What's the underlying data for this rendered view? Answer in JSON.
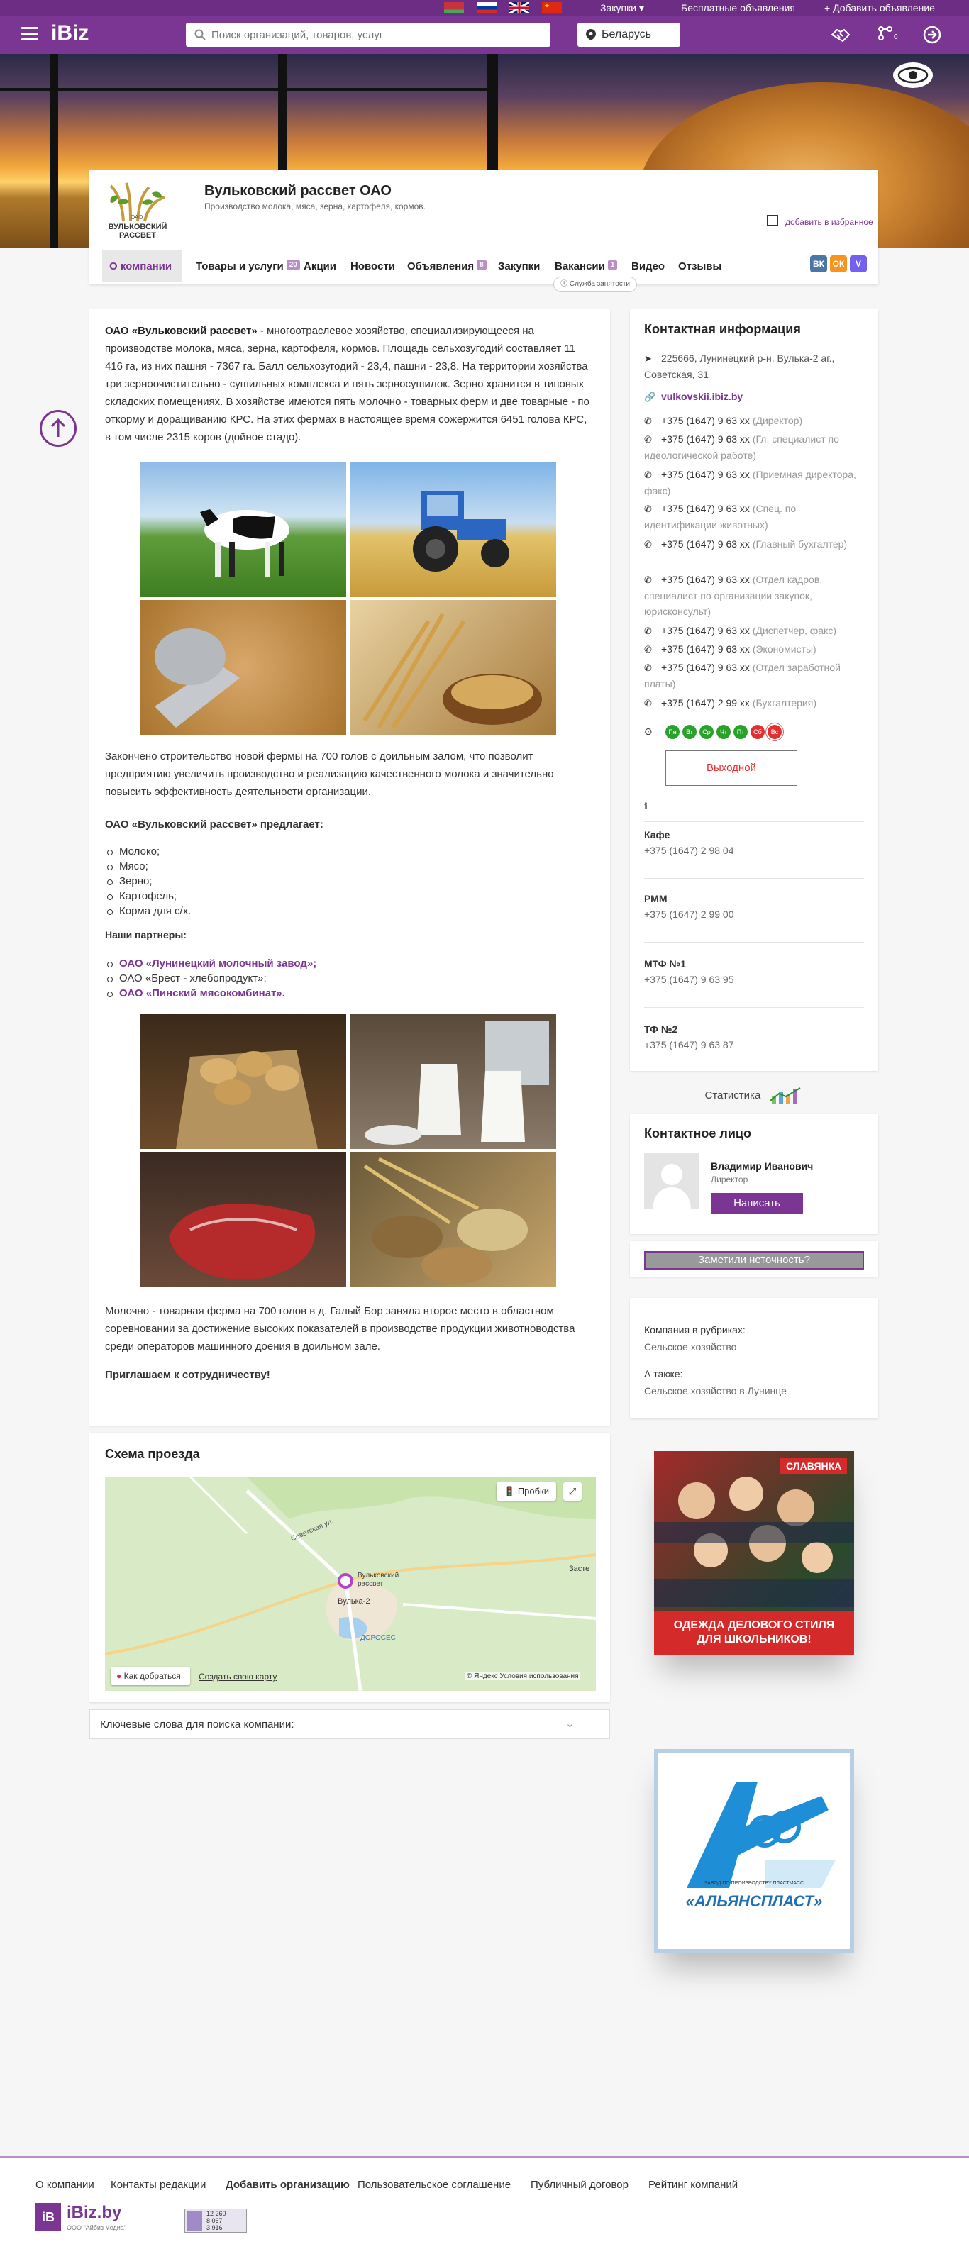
{
  "topbar": {
    "flags": [
      "by-flag",
      "ru-flag",
      "uk-flag",
      "cn-flag"
    ],
    "purchases": "Закупки",
    "free_ads": "Бесплатные объявления",
    "add_ad": "Добавить объявление"
  },
  "header": {
    "logo": "iBiz",
    "search_placeholder": "Поиск организаций, товаров, услуг",
    "country": "Беларусь",
    "notification_count": "0"
  },
  "company": {
    "logo_text": "ВУЛЬКОВСКИЙ РАССВЕТ",
    "logo_small": "ОАО",
    "name": "Вульковский рассвет ОАО",
    "description": "Производство молока, мяса, зерна, картофеля, кормов.",
    "favorite": "добавить в избранное"
  },
  "tabs": [
    {
      "label": "О компании"
    },
    {
      "label": "Товары и услуги",
      "badge": "20"
    },
    {
      "label": "Акции"
    },
    {
      "label": "Новости"
    },
    {
      "label": "Объявления",
      "badge": "8"
    },
    {
      "label": "Закупки"
    },
    {
      "label": "Вакансии",
      "badge": "1"
    },
    {
      "label": "Видео"
    },
    {
      "label": "Отзывы"
    }
  ],
  "social": [
    "ВК",
    "ОК",
    "V"
  ],
  "support": "Служба занятости",
  "about": {
    "intro_bold": "ОАО «Вульковский рассвет»",
    "intro": " - многоотраслевое хозяйство, специализирующееся на производстве молока, мяса, зерна, картофеля, кормов. Площадь сельхозугодий составляет 11 416 га, из них пашня - 7367 га. Балл сельхозугодий - 23,4, пашни - 23,8. На территории хозяйства три зерноочистительно - сушильных комплекса и пять зерносушилок. Зерно хранится в типовых складских помещениях. В хозяйстве имеются пять молочно - товарных ферм и две товарные - по откорму и доращиванию КРС. На этих фермах в настоящее время сожержится 6451 голова КРС, в том числе 2315 коров (дойное стадо).",
    "farm": "Закончено строительство новой фермы на 700 голов с доильным залом, что позволит предприятию увеличить производство  и реализацию качественного молока и значительно повысить эффективность деятельности организации.",
    "offers_title": "ОАО «Вульковский рассвет» предлагает:",
    "offers": [
      "Молоко;",
      "Мясо;",
      "Зерно;",
      "Картофель;",
      "Корма для с/х."
    ],
    "partners_title": "Наши партнеры:",
    "partners": [
      "ОАО «Лунинецкий молочный завод»;",
      "ОАО «Брест - хлебопродукт»;",
      "ОАО «Пинский мясокомбинат»."
    ],
    "award": "Молочно - товарная ферма на 700 голов в д. Галый Бор заняла второе место в областном соревновании за достижение высоких показателей в производстве продукции животноводства среди операторов машинного доения в доильном зале.",
    "invite": "Приглашаем к сотрудничеству!"
  },
  "map": {
    "title": "Схема проезда",
    "traffic": "Пробки",
    "route": "Как добраться",
    "create": "Создать свою карту",
    "copyright": "© Яндекс",
    "terms": "Условия использования",
    "place_label": "Вульковский рассвет",
    "village": "Вулька-2",
    "lake": "ДОРОСЕС",
    "street": "Советская ул.",
    "east": "Засте"
  },
  "keywords": "Ключевые слова для поиска компании:",
  "contacts": {
    "title": "Контактная информация",
    "address": "225666, Лунинецкий р-н, Вулька-2 аг., Советская, 31",
    "site": "vulkovskii.ibiz.by",
    "phones": [
      {
        "num": "+375 (1647) 9 63 хх",
        "note": "(Директор)"
      },
      {
        "num": "+375 (1647) 9 63 хх",
        "note": "(Гл. специалист по идеологической работе)"
      },
      {
        "num": "+375 (1647) 9 63 хх",
        "note": "(Приемная директора, факс)"
      },
      {
        "num": "+375 (1647) 9 63 хх",
        "note": "(Спец. по идентификации животных)"
      },
      {
        "num": "+375 (1647) 9 63 хх",
        "note": "(Главный бухгалтер)"
      },
      {
        "num": "+375 (1647) 9 63 хх",
        "note": "(Отдел кадров, специалист по организации закупок, юрисконсульт)"
      },
      {
        "num": "+375 (1647) 9 63 хх",
        "note": "(Диспетчер, факс)"
      },
      {
        "num": "+375 (1647) 9 63 хх",
        "note": "(Экономисты)"
      },
      {
        "num": "+375 (1647) 9 63 хх",
        "note": "(Отдел заработной платы)"
      },
      {
        "num": "+375 (1647) 2 99 хх",
        "note": "(Бухгалтерия)"
      }
    ],
    "days": [
      "Пн",
      "Вт",
      "Ср",
      "Чт",
      "Пт",
      "Сб",
      "Вс"
    ],
    "day_colors": [
      "#2aa12a",
      "#2aa12a",
      "#2aa12a",
      "#2aa12a",
      "#2aa12a",
      "#e23030",
      "#e23030"
    ],
    "dayoff": "Выходной",
    "departments": [
      {
        "name": "Кафе",
        "phone": "+375 (1647) 2 98 04"
      },
      {
        "name": "РММ",
        "phone": "+375 (1647) 2 99 00"
      },
      {
        "name": "МТФ №1",
        "phone": "+375 (1647) 9 63 95"
      },
      {
        "name": "ТФ №2",
        "phone": "+375 (1647) 9 63 87"
      }
    ]
  },
  "stats": "Статистика",
  "contact_person": {
    "title": "Контактное лицо",
    "name": "Владимир Иванович",
    "role": "Директор",
    "write": "Написать"
  },
  "mistake": "Заметили неточность?",
  "rubrics": {
    "title": "Компания в рубриках:",
    "rubric": "Сельское хозяйство",
    "also": "А также:",
    "also_item": "Сельское хозяйство в Лунинце"
  },
  "ads": {
    "slavyanka": "СЛАВЯНКА",
    "slavyanka_text": "ОДЕЖДА ДЕЛОВОГО СТИЛЯ ДЛЯ ШКОЛЬНИКОВ!",
    "aliansplast": "«АЛЬЯНСПЛАСТ»",
    "aliansplast_top": "ЗАВОД ПО ПРОИЗВОДСТВУ ПЛАСТМАСС"
  },
  "footer": {
    "links": [
      "О компании",
      "Контакты редакции",
      "Добавить организацию",
      "Пользовательское соглашение",
      "Публичный договор",
      "Рейтинг компаний"
    ],
    "logo": "iBiz.by",
    "logo_sub": "ООО \"Айбиз медиа\"",
    "counter": [
      "12 260",
      "8 067",
      "3 916"
    ]
  },
  "colors": {
    "brand": "#7b3593",
    "brand_dark": "#6d2d85",
    "green": "#2aa12a",
    "red": "#e23030"
  }
}
